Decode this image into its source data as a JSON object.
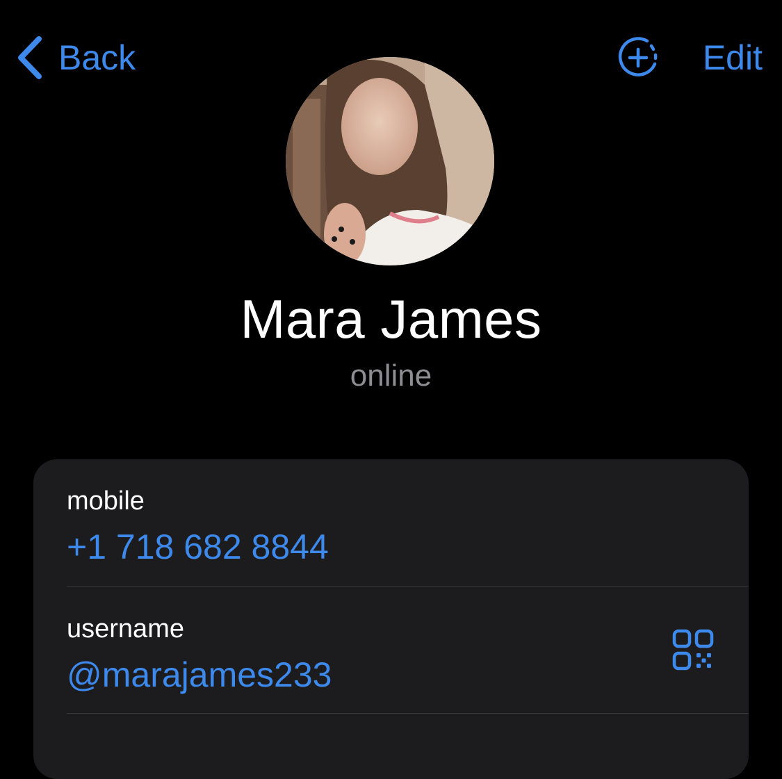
{
  "nav": {
    "back_label": "Back",
    "back_icon": "chevron-left-icon",
    "add_story_icon": "add-story-circle-icon",
    "edit_label": "Edit"
  },
  "profile": {
    "name": "Mara James",
    "status": "online",
    "avatar_icon": "profile-photo"
  },
  "info": {
    "mobile_label": "mobile",
    "mobile_value": "+1 718 682 8844",
    "username_label": "username",
    "username_value": "@marajames233",
    "qr_icon": "qr-code-icon"
  },
  "colors": {
    "accent": "#3e89ec",
    "background": "#000000",
    "card": "#1c1c1e",
    "secondary_text": "#8d8d92",
    "divider": "#3a3a3c"
  }
}
